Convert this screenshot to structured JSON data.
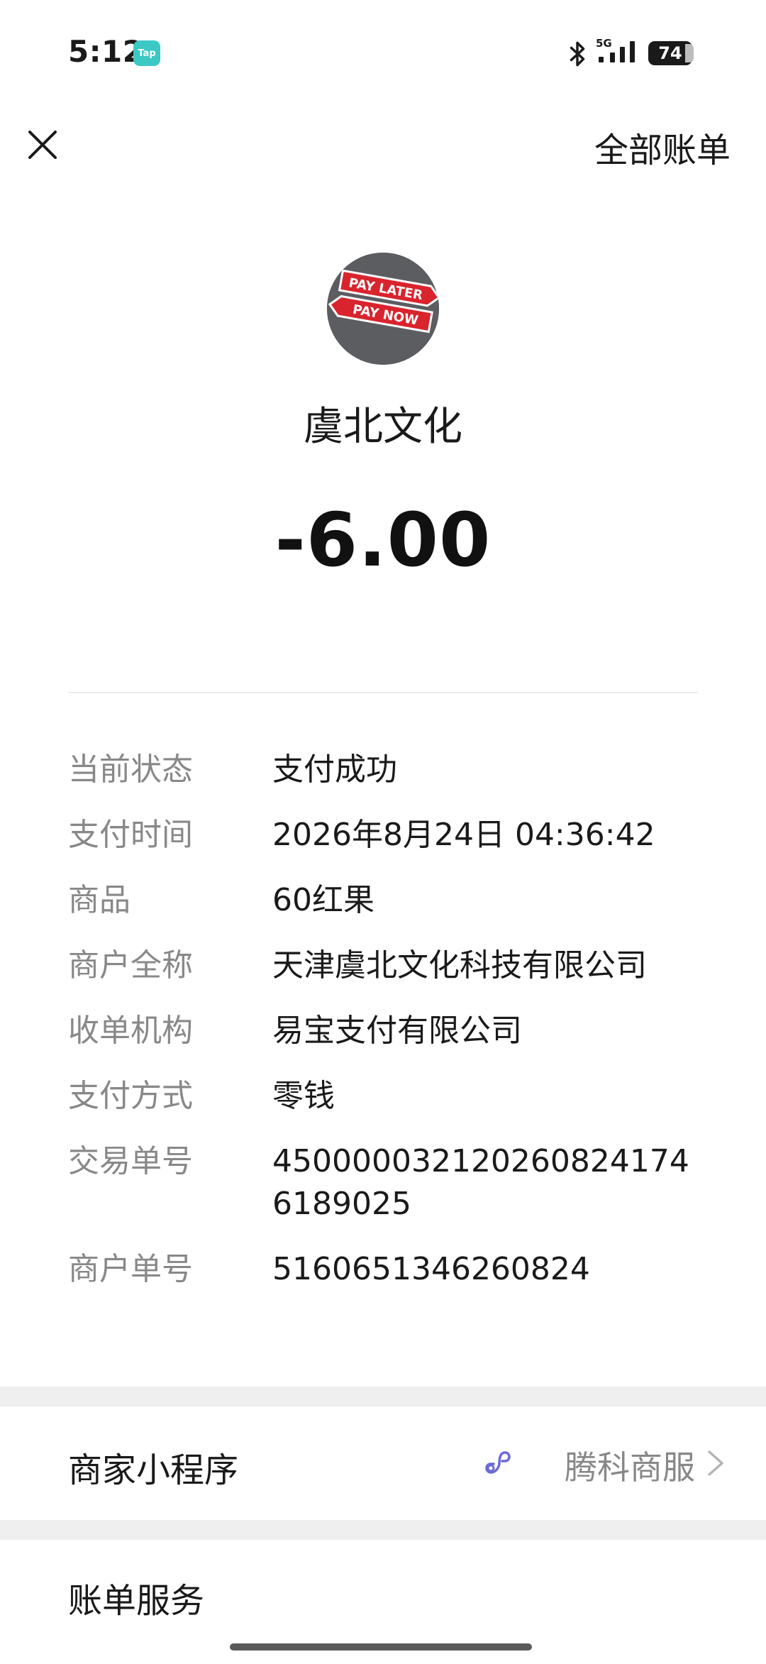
{
  "status_bar": {
    "time": "5:12",
    "tap_badge": "Tap",
    "network": "5G",
    "battery": "74"
  },
  "nav": {
    "close_icon": "close-icon",
    "all_bills": "全部账单"
  },
  "merchant": {
    "avatar_text_1": "PAY LATER",
    "avatar_text_2": "PAY NOW",
    "name": "虞北文化",
    "amount": "-6.00"
  },
  "details": [
    {
      "key": "当前状态",
      "value": "支付成功"
    },
    {
      "key": "支付时间",
      "value": "2026年8月24日 04:36:42"
    },
    {
      "key": "商品",
      "value": "60红果"
    },
    {
      "key": "商户全称",
      "value": "天津虞北文化科技有限公司"
    },
    {
      "key": "收单机构",
      "value": "易宝支付有限公司"
    },
    {
      "key": "支付方式",
      "value": "零钱"
    },
    {
      "key": "交易单号",
      "value": "4500000321202608241746189025"
    },
    {
      "key": "商户单号",
      "value": "5160651346260824"
    }
  ],
  "mini_program": {
    "label": "商家小程序",
    "link_text": "腾科商服"
  },
  "bill_service": {
    "label": "账单服务"
  },
  "colors": {
    "key_text": "#888888",
    "value_text": "#1a1a1a",
    "section_gap": "#efefef",
    "link_icon": "#6b6bd6"
  }
}
